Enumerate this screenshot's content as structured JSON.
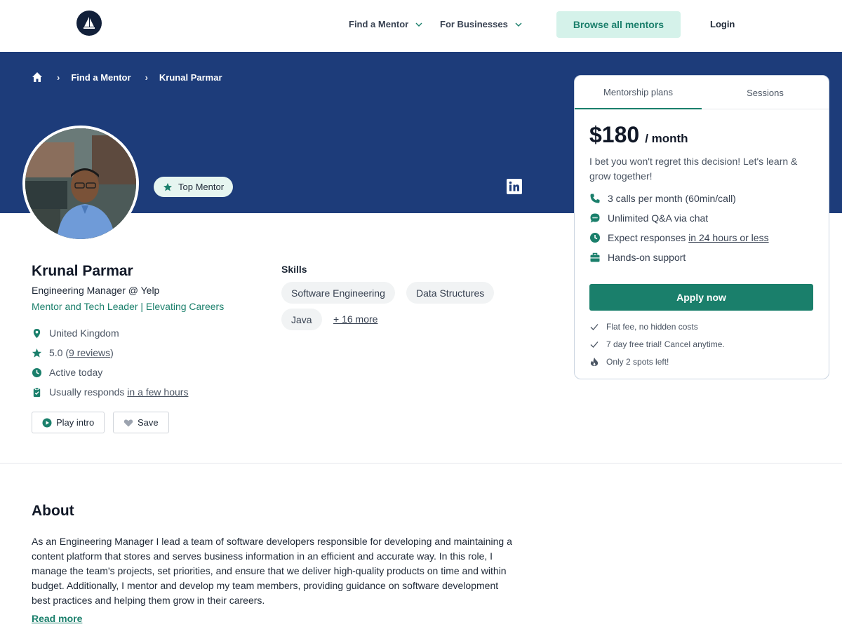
{
  "header": {
    "nav": [
      "Find a Mentor",
      "For Businesses"
    ],
    "browse_label": "Browse all mentors",
    "login_label": "Login"
  },
  "breadcrumb": {
    "items": [
      "Find a Mentor",
      "Krunal Parmar"
    ]
  },
  "badge": {
    "label": "Top Mentor"
  },
  "profile": {
    "name": "Krunal Parmar",
    "role": "Engineering Manager @ Yelp",
    "tagline": "Mentor and Tech Leader | Elevating Careers",
    "location": "United Kingdom",
    "rating": "5.0",
    "rating_open": "(",
    "reviews": "9 reviews",
    "rating_close": ")",
    "activity": "Active today",
    "responds_prefix": "Usually responds",
    "responds_link": "in a few hours",
    "play_intro": "Play intro",
    "save": "Save"
  },
  "skills": {
    "title": "Skills",
    "items": [
      "Software Engineering",
      "Data Structures",
      "Java"
    ],
    "more": "+ 16 more"
  },
  "about": {
    "title": "About",
    "text": "As an Engineering Manager I lead a team of software developers responsible for developing and maintaining a content platform that stores and serves business information in an efficient and accurate way. In this role, I manage the team's projects, set priorities, and ensure that we deliver high-quality products on time and within budget. Additionally, I mentor and develop my team members, providing guidance on software development best practices and helping them grow in their careers.",
    "read_more": "Read more"
  },
  "plans": {
    "tabs": [
      "Mentorship plans",
      "Sessions"
    ],
    "price": "$180",
    "period": "/ month",
    "pitch": "I bet you won't regret this decision! Let's learn & grow together!",
    "features": {
      "calls": "3 calls per month (60min/call)",
      "qa": "Unlimited Q&A via chat",
      "responses_prefix": "Expect responses",
      "responses_link": "in 24 hours or less",
      "support": "Hands-on support"
    },
    "apply_label": "Apply now",
    "notes": [
      "Flat fee, no hidden costs",
      "7 day free trial! Cancel anytime.",
      "Only 2 spots left!"
    ]
  },
  "colors": {
    "brand_navy": "#1d3c7a",
    "accent_green": "#1a7f6b",
    "accent_light": "#d5f2ea"
  },
  "icons": [
    "logo-icon",
    "chevron-down-icon",
    "home-icon",
    "star-icon",
    "linkedin-icon",
    "location-icon",
    "clock-icon",
    "clipboard-icon",
    "play-icon",
    "heart-icon",
    "phone-icon",
    "chat-icon",
    "briefcase-icon",
    "check-icon",
    "fire-icon"
  ]
}
